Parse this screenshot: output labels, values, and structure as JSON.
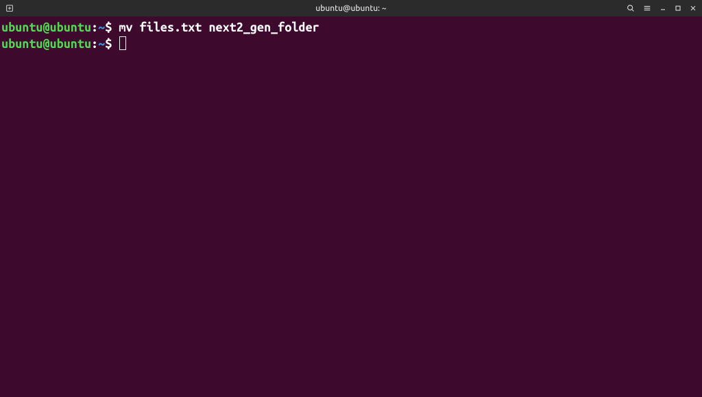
{
  "titlebar": {
    "title": "ubuntu@ubuntu: ~"
  },
  "terminal": {
    "lines": [
      {
        "user_host": "ubuntu@ubuntu",
        "colon": ":",
        "path": "~",
        "dollar": "$ ",
        "command": "mv files.txt next2_gen_folder"
      },
      {
        "user_host": "ubuntu@ubuntu",
        "colon": ":",
        "path": "~",
        "dollar": "$ ",
        "command": ""
      }
    ]
  }
}
